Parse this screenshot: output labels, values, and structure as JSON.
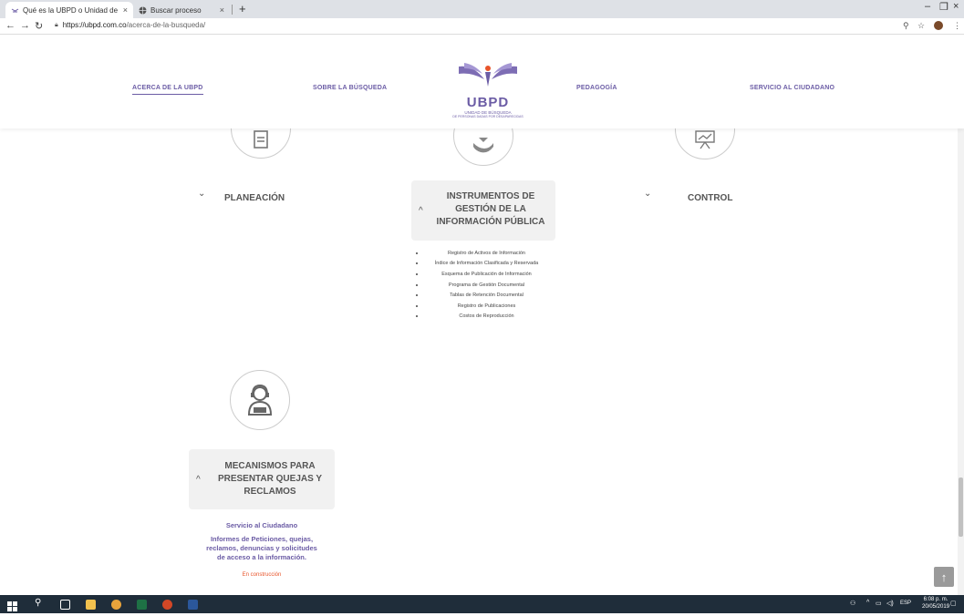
{
  "browser": {
    "tabs": [
      {
        "title": "Qué es la UBPD o Unidad de bús",
        "close": "×"
      },
      {
        "title": "Buscar proceso",
        "close": "×"
      }
    ],
    "new_tab": "+",
    "window_controls": {
      "minimize": "–",
      "maximize": "❐",
      "close": "×"
    },
    "url_host": "https://ubpd.com.co",
    "url_path": "/acerca-de-la-busqueda/"
  },
  "header": {
    "nav": [
      {
        "label": "ACERCA DE LA UBPD"
      },
      {
        "label": "SOBRE LA BÚSQUEDA"
      },
      {
        "label": "PEDAGOGÍA"
      },
      {
        "label": "SERVICIO AL CIUDADANO"
      }
    ],
    "logo": {
      "brand": "UBPD",
      "subtitle": "UNIDAD DE BÚSQUEDA",
      "tagline": "DE PERSONAS DADAS POR DESAPARECIDAS"
    }
  },
  "sections": {
    "planeacion": {
      "label": "PLANEACIÓN",
      "chevron": "⌄"
    },
    "instrumentos": {
      "label_lines": [
        "INSTRUMENTOS DE",
        "GESTIÓN DE LA",
        "INFORMACIÓN PÚBLICA"
      ],
      "chevron": "^"
    },
    "control": {
      "label": "CONTROL",
      "chevron": "⌄"
    },
    "mecanismos": {
      "label_lines": [
        "MECANISMOS PARA",
        "PRESENTAR QUEJAS Y",
        "RECLAMOS"
      ],
      "chevron": "^"
    }
  },
  "documents": [
    "Registro de Activos de Información",
    "Índice de Información Clasificada y Reservada",
    "Esquema de Publicación de Información",
    "Programa de Gestión Documental",
    "Tablas de Retención Documental",
    "Registro de Publicaciones",
    "Costos de Reproducción"
  ],
  "servicio": {
    "title": "Servicio al Ciudadano",
    "desc_lines": [
      "Informes de Peticiones, quejas,",
      "reclamos, denuncias y solicitudes",
      "de acceso a la información."
    ],
    "note": "En construcción"
  },
  "taskbar": {
    "lang": "ESP",
    "time": "6:08 p. m.",
    "date": "20/05/2019"
  },
  "colors": {
    "brand": "#6b5ca5",
    "accent_orange": "#e8542a",
    "taskbar": "#1f2d3a"
  }
}
